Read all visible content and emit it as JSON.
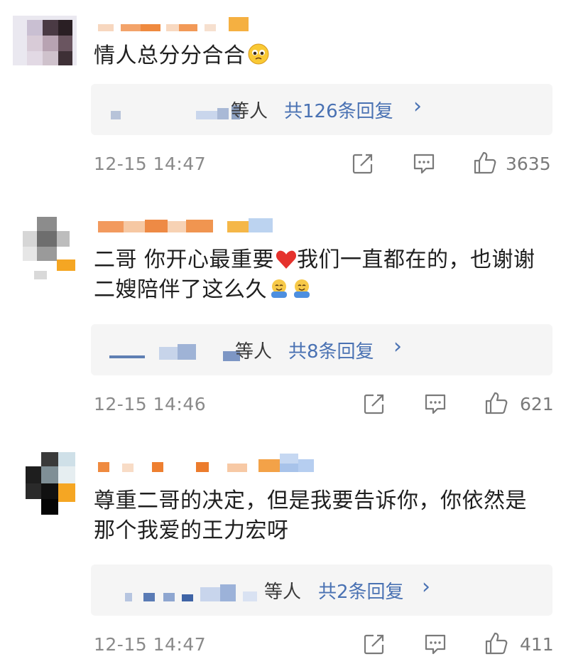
{
  "comments": [
    {
      "text": "情人总分分合合",
      "emoji": "pleading-face",
      "reply_prefix": "等人",
      "reply_count": "共126条回复",
      "time": "12-15 14:47",
      "likes": "3635"
    },
    {
      "text": "二哥 你开心最重要",
      "text2": "我们一直都在的，也谢谢二嫂陪伴了这么久",
      "emoji": "red-heart",
      "trail_emoji": "hugging-face",
      "reply_prefix": "等人",
      "reply_count": "共8条回复",
      "time": "12-15 14:46",
      "likes": "621"
    },
    {
      "text": "尊重二哥的决定，但是我要告诉你，你依然是那个我爱的王力宏呀",
      "reply_prefix": "等人",
      "reply_count": "共2条回复",
      "time": "12-15 14:47",
      "likes": "411"
    }
  ],
  "chevron": "›",
  "colors": {
    "link": "#4a72b3",
    "meta": "#8a8a8a",
    "reply_bg": "#f5f5f5",
    "heart": "#e5322d"
  }
}
